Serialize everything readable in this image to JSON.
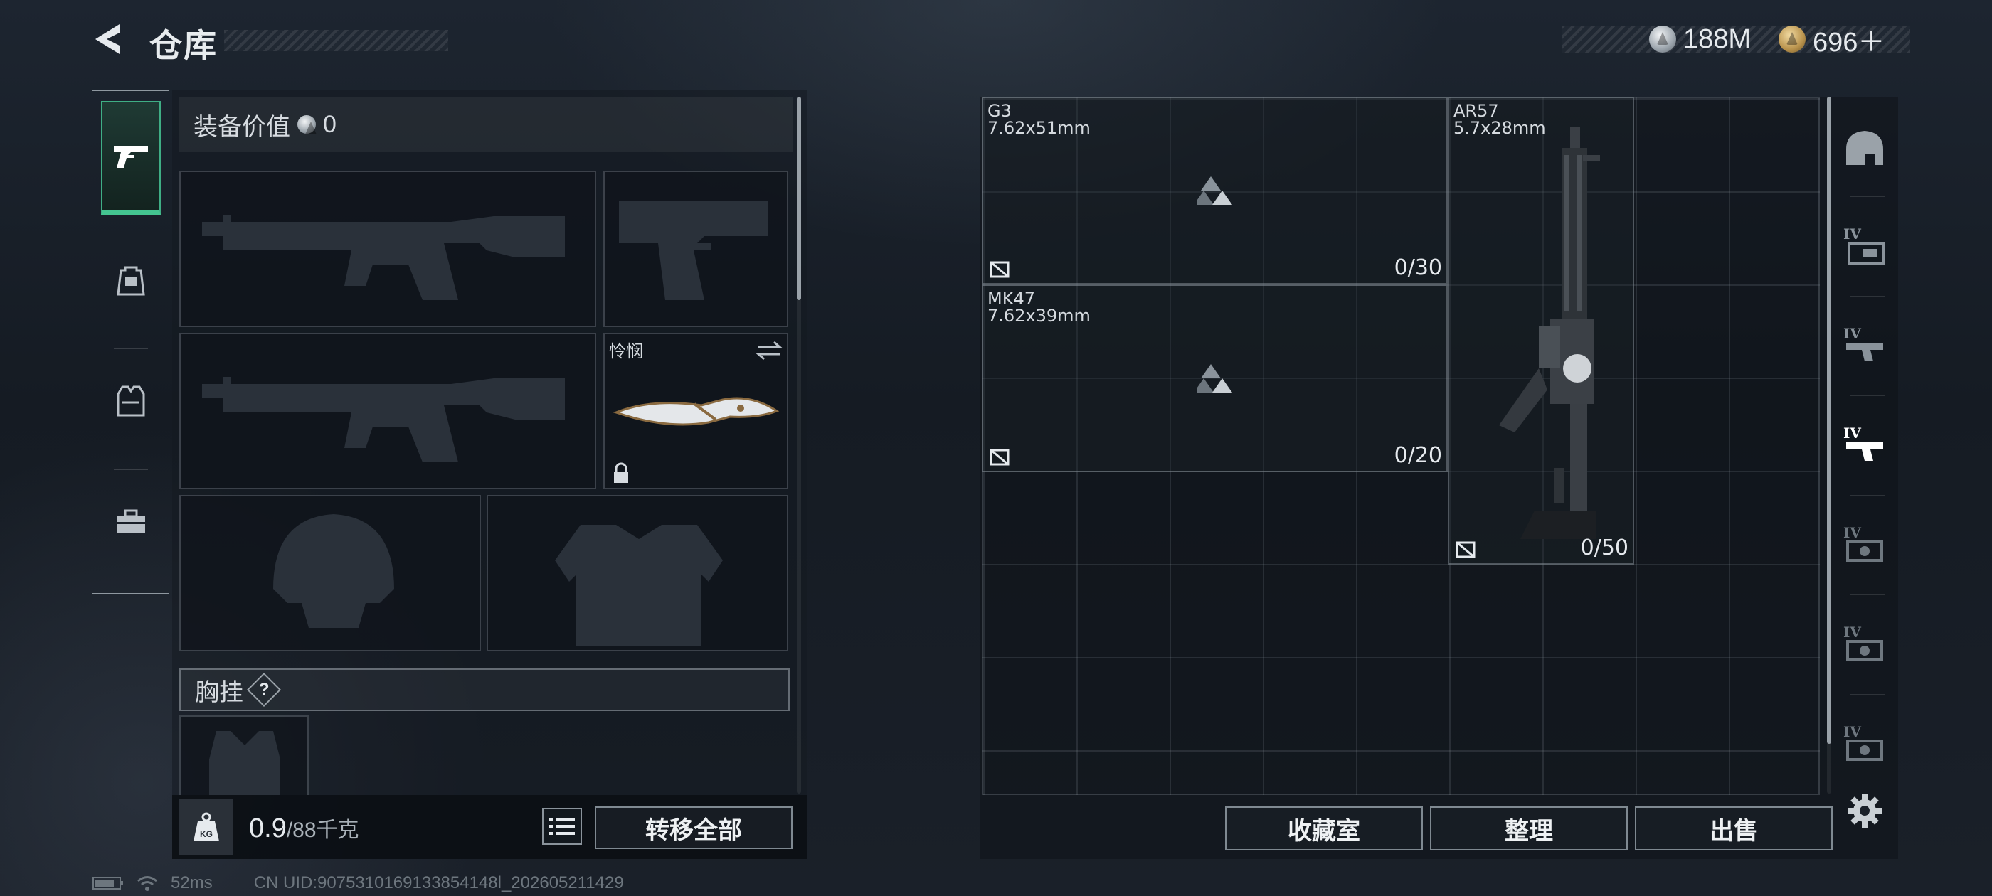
{
  "header": {
    "title": "仓库",
    "currency_silver": "188M",
    "currency_gold": "696＋"
  },
  "left_tabs": [
    {
      "name": "pistol-icon",
      "active": true
    },
    {
      "name": "backpack-icon",
      "active": false
    },
    {
      "name": "vest-icon",
      "active": false
    },
    {
      "name": "toolbox-icon",
      "active": false
    }
  ],
  "loadout": {
    "equipment_value_label": "装备价值",
    "equipment_value": "0",
    "melee_slot_label": "怜悯",
    "chest_rig_label": "胸挂",
    "chest_rig_help": "?"
  },
  "bottom_left": {
    "weight_current": "0.9",
    "weight_capacity": "/88千克",
    "kg_badge": "KG",
    "transfer_all": "转移全部"
  },
  "ammo_items": [
    {
      "name": "G3",
      "caliber": "7.62x51mm",
      "count": "0/30"
    },
    {
      "name": "MK47",
      "caliber": "7.62x39mm",
      "count": "0/20"
    },
    {
      "name": "AR57",
      "caliber": "5.7x28mm",
      "count": "0/50"
    }
  ],
  "right_categories": [
    {
      "name": "helmet-category-icon",
      "tier": ""
    },
    {
      "name": "tier-weapon-1-icon",
      "tier": "IV"
    },
    {
      "name": "tier-weapon-2-icon",
      "tier": "IV"
    },
    {
      "name": "tier-weapon-3-icon",
      "tier": "IV"
    },
    {
      "name": "tier-gear-1-icon",
      "tier": "IV"
    },
    {
      "name": "tier-gear-2-icon",
      "tier": "IV"
    },
    {
      "name": "tier-gear-3-icon",
      "tier": "IV"
    }
  ],
  "bottom_right": {
    "collection_room": "收藏室",
    "organize": "整理",
    "sell": "出售"
  },
  "status": {
    "ping": "52ms",
    "uid": "CN UID:9075310169133854148l_202605211429"
  }
}
